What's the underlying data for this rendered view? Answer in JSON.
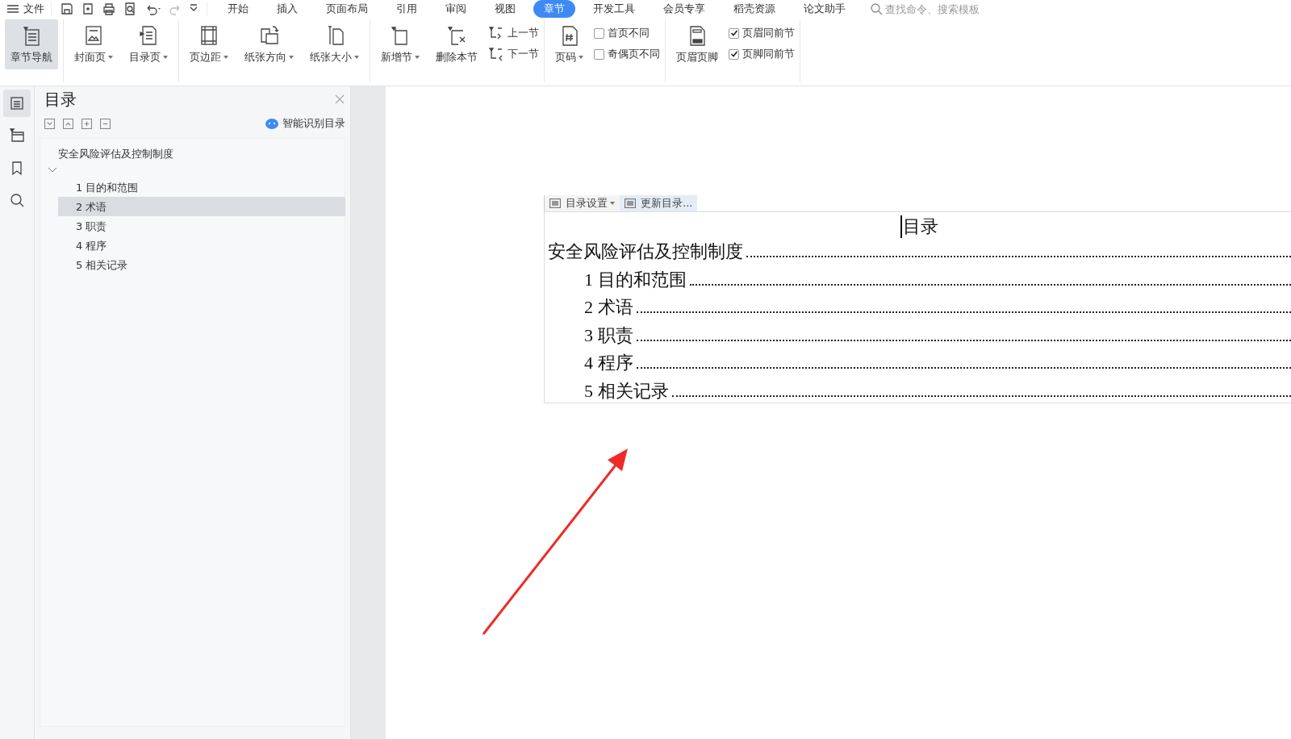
{
  "menu": {
    "label": "文件"
  },
  "tabs": [
    {
      "label": "开始",
      "selected": false
    },
    {
      "label": "插入",
      "selected": false
    },
    {
      "label": "页面布局",
      "selected": false
    },
    {
      "label": "引用",
      "selected": false
    },
    {
      "label": "审阅",
      "selected": false
    },
    {
      "label": "视图",
      "selected": false
    },
    {
      "label": "章节",
      "selected": true
    },
    {
      "label": "开发工具",
      "selected": false
    },
    {
      "label": "会员专享",
      "selected": false
    },
    {
      "label": "稻壳资源",
      "selected": false
    },
    {
      "label": "论文助手",
      "selected": false
    }
  ],
  "search": {
    "placeholder": "查找命令、搜索模板"
  },
  "ribbon": {
    "groups": [
      [
        {
          "kind": "big",
          "label": "章节导航",
          "dropdown": false,
          "selected": true
        }
      ],
      [
        {
          "kind": "big",
          "label": "封面页",
          "dropdown": true,
          "selected": false
        },
        {
          "kind": "big",
          "label": "目录页",
          "dropdown": true,
          "selected": false
        }
      ],
      [
        {
          "kind": "big",
          "label": "页边距",
          "dropdown": true,
          "selected": false
        },
        {
          "kind": "big",
          "label": "纸张方向",
          "dropdown": true,
          "selected": false
        },
        {
          "kind": "big",
          "label": "纸张大小",
          "dropdown": true,
          "selected": false
        }
      ],
      [
        {
          "kind": "big",
          "label": "新增节",
          "dropdown": true,
          "selected": false
        },
        {
          "kind": "big",
          "label": "删除本节",
          "dropdown": false,
          "selected": false
        },
        {
          "kind": "stack",
          "items": [
            {
              "label": "上一节"
            },
            {
              "label": "下一节"
            }
          ]
        }
      ],
      [
        {
          "kind": "big",
          "label": "页码",
          "dropdown": true,
          "selected": false
        },
        {
          "kind": "checks",
          "items": [
            {
              "label": "首页不同",
              "checked": false
            },
            {
              "label": "奇偶页不同",
              "checked": false
            }
          ]
        }
      ],
      [
        {
          "kind": "big",
          "label": "页眉页脚",
          "dropdown": false,
          "selected": false
        },
        {
          "kind": "checks",
          "items": [
            {
              "label": "页眉同前节",
              "checked": true
            },
            {
              "label": "页脚同前节",
              "checked": true
            }
          ]
        }
      ]
    ]
  },
  "rail": [
    {
      "selected": true
    },
    {
      "selected": false
    },
    {
      "selected": false
    },
    {
      "selected": false
    }
  ],
  "panel": {
    "title": "目录",
    "smart_button": "智能识别目录",
    "tree": [
      {
        "label": "安全风险评估及控制制度",
        "expanded": true,
        "selected": false,
        "children": [
          {
            "label": "1 目的和范围",
            "selected": false
          },
          {
            "label": "2 术语",
            "selected": true
          },
          {
            "label": "3 职责",
            "selected": false
          },
          {
            "label": "4 程序",
            "selected": false
          },
          {
            "label": "5 相关记录",
            "selected": false
          }
        ]
      }
    ]
  },
  "document": {
    "toc_toolbar": [
      {
        "label": "目录设置",
        "dropdown": true,
        "selected": false
      },
      {
        "label": "更新目录...",
        "dropdown": false,
        "selected": true
      }
    ],
    "toc_title": "目录",
    "toc": [
      {
        "text": "安全风险评估及控制制度",
        "children": [
          {
            "text": "1 目的和范围"
          },
          {
            "text": "2 术语"
          },
          {
            "text": "3 职责"
          },
          {
            "text": "4 程序"
          },
          {
            "text": "5 相关记录"
          }
        ]
      }
    ]
  }
}
